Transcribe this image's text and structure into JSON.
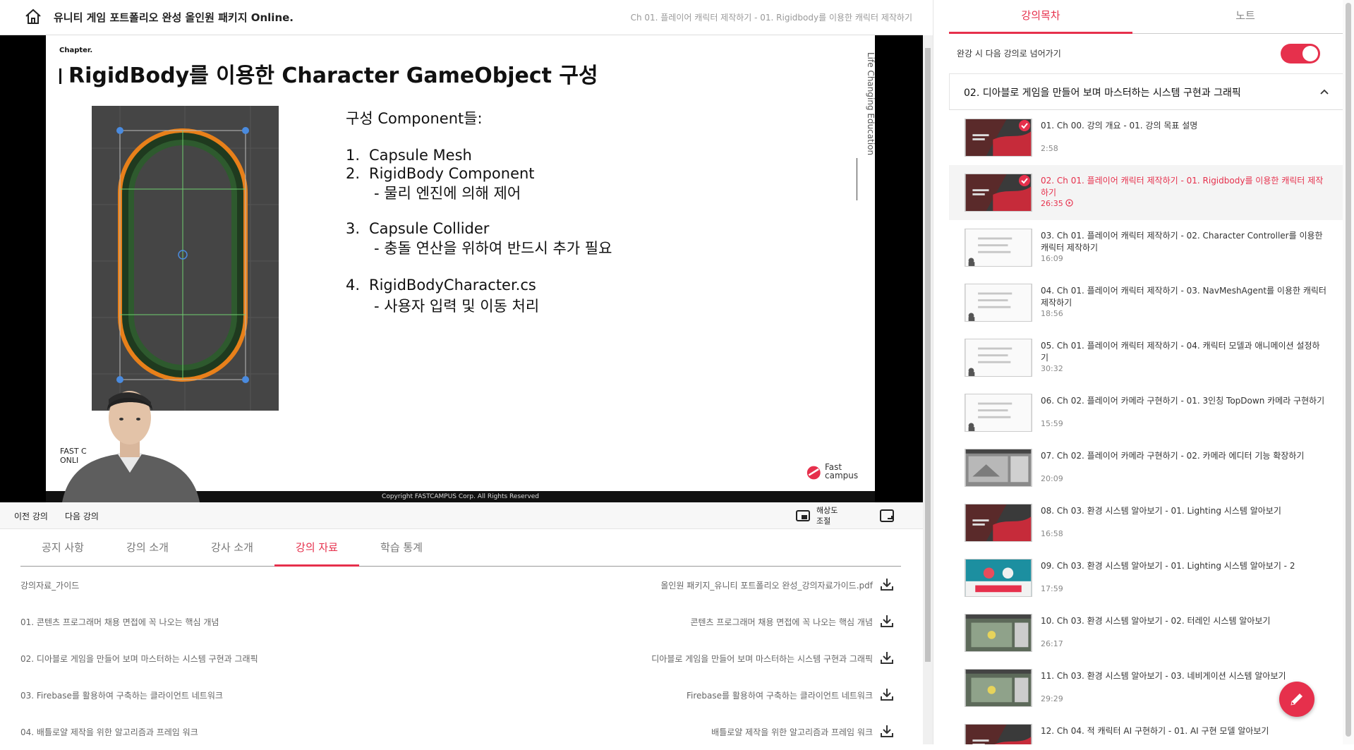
{
  "header": {
    "course_title": "유니티 게임 포트폴리오 완성 올인원 패키지 Online.",
    "current_lecture": "Ch 01. 플레이어 캐릭터 제작하기 - 01. Rigidbody를 이용한 캐릭터 제작하기"
  },
  "slide": {
    "chapter_label": "Chapter.",
    "heading": "RigidBody를 이용한 Character GameObject 구성",
    "components_title": "구성 Component들:",
    "items": [
      {
        "num": "1.",
        "text": "Capsule Mesh"
      },
      {
        "num": "2.",
        "text": "RigidBody Component"
      },
      {
        "num": "3.",
        "text": "Capsule Collider"
      },
      {
        "num": "4.",
        "text": "RigidBodyCharacter.cs"
      }
    ],
    "sub_items": [
      "-    물리 엔진에 의해 제어",
      "-    충돌 연산을 위하여 반드시 추가 필요",
      "- 사용자 입력 및 이동 처리"
    ],
    "vertical_text": "Life Changing Education",
    "fast_online": "FAST C\nONLI",
    "logo_text": "Fast\ncampus",
    "copyright": "Copyright FASTCAMPUS Corp. All Rights Reserved"
  },
  "controls": {
    "prev": "이전 강의",
    "next": "다음 강의",
    "resolution": "해상도 조절"
  },
  "tabs": [
    {
      "label": "공지 사항",
      "active": false
    },
    {
      "label": "강의 소개",
      "active": false
    },
    {
      "label": "강사 소개",
      "active": false
    },
    {
      "label": "강의 자료",
      "active": true
    },
    {
      "label": "학습 통계",
      "active": false
    }
  ],
  "materials": [
    {
      "name": "강의자료_가이드",
      "file": "올인원 패키지_유니티 포트폴리오 완성_강의자료가이드.pdf"
    },
    {
      "name": "01. 콘텐츠 프로그래머 채용 면접에 꼭 나오는 핵심 개념",
      "file": "콘텐츠 프로그래머 채용 면접에 꼭 나오는 핵심 개념"
    },
    {
      "name": "02. 디아블로 게임을 만들어 보며 마스터하는 시스템 구현과 그래픽",
      "file": "디아블로 게임을 만들어 보며 마스터하는 시스템 구현과 그래픽"
    },
    {
      "name": "03. Firebase를 활용하여 구축하는 클라이언트 네트워크",
      "file": "Firebase를 활용하여 구축하는 클라이언트 네트워크"
    },
    {
      "name": "04. 배틀로얄 제작을 위한 알고리즘과 프레임 워크",
      "file": "배틀로얄 제작을 위한 알고리즘과 프레임 워크"
    }
  ],
  "sidebar": {
    "tabs": [
      {
        "label": "강의목차",
        "active": true
      },
      {
        "label": "노트",
        "active": false
      }
    ],
    "autoplay_label": "완강 시 다음 강의로 넘어가기",
    "autoplay_on": true,
    "section_title": "02. 디아블로 게임을 만들어 보며 마스터하는 시스템 구현과 그래픽",
    "lectures": [
      {
        "title": "01. Ch 00. 강의 개요 - 01. 강의 목표 설명",
        "duration": "2:58",
        "done": true,
        "current": false,
        "thumb": "red"
      },
      {
        "title": "02. Ch 01. 플레이어 캐릭터 제작하기 - 01. Rigidbody를 이용한 캐릭터 제작하기",
        "duration": "26:35",
        "done": true,
        "current": true,
        "thumb": "red"
      },
      {
        "title": "03. Ch 01. 플레이어 캐릭터 제작하기 - 02. Character Controller를 이용한 캐릭터 제작하기",
        "duration": "16:09",
        "done": false,
        "current": false,
        "thumb": "slide"
      },
      {
        "title": "04. Ch 01. 플레이어 캐릭터 제작하기 - 03. NavMeshAgent를 이용한 캐릭터 제작하기",
        "duration": "18:56",
        "done": false,
        "current": false,
        "thumb": "slide"
      },
      {
        "title": "05. Ch 01. 플레이어 캐릭터 제작하기 - 04. 캐릭터 모델과 애니메이션 설정하기",
        "duration": "30:32",
        "done": false,
        "current": false,
        "thumb": "slide"
      },
      {
        "title": "06. Ch 02. 플레이어 카메라 구현하기 - 01. 3인칭 TopDown 카메라 구현하기",
        "duration": "15:59",
        "done": false,
        "current": false,
        "thumb": "slide"
      },
      {
        "title": "07. Ch 02. 플레이어 카메라 구현하기 - 02. 카메라 에디터 기능 확장하기",
        "duration": "20:09",
        "done": false,
        "current": false,
        "thumb": "editor"
      },
      {
        "title": "08. Ch 03. 환경 시스템 알아보기 - 01. Lighting 시스템 알아보기",
        "duration": "16:58",
        "done": false,
        "current": false,
        "thumb": "red"
      },
      {
        "title": "09. Ch 03. 환경 시스템 알아보기 - 01. Lighting 시스템 알아보기 - 2",
        "duration": "17:59",
        "done": false,
        "current": false,
        "thumb": "probes"
      },
      {
        "title": "10. Ch 03. 환경 시스템 알아보기 - 02. 터레인 시스템 알아보기",
        "duration": "26:17",
        "done": false,
        "current": false,
        "thumb": "scene"
      },
      {
        "title": "11. Ch 03. 환경 시스템 알아보기 - 03. 네비게이션 시스템 알아보기",
        "duration": "29:29",
        "done": false,
        "current": false,
        "thumb": "scene"
      },
      {
        "title": "12. Ch 04. 적 캐릭터 AI 구현하기 - 01. AI 구현 모델 알아보기",
        "duration": "",
        "done": false,
        "current": false,
        "thumb": "red"
      }
    ]
  },
  "colors": {
    "accent": "#e6304c"
  }
}
